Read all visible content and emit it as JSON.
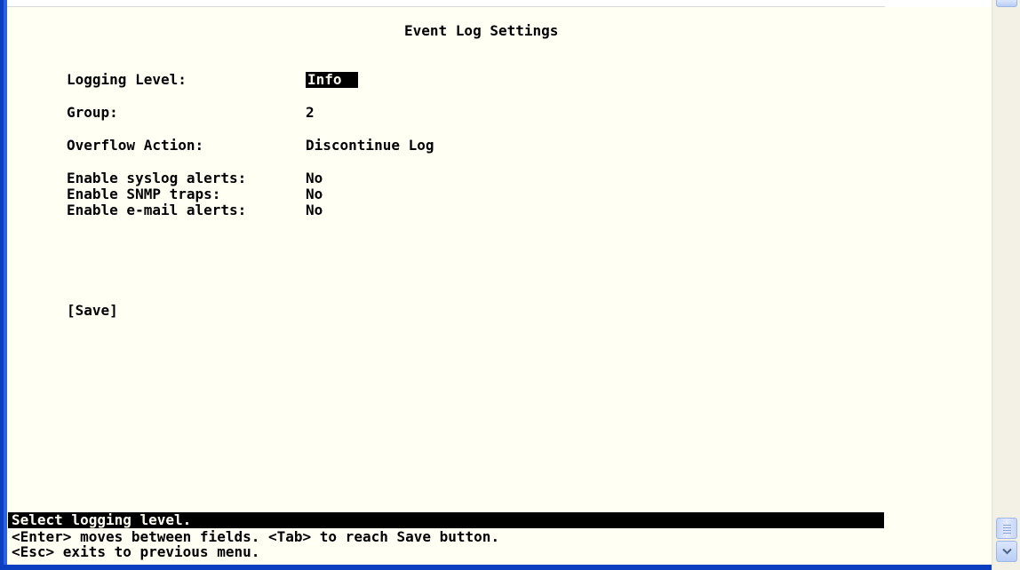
{
  "screen": {
    "title": "Event Log Settings",
    "fields": [
      {
        "label": "Logging Level:",
        "value": "Info"
      },
      {
        "label": "Group:",
        "value": "2"
      },
      {
        "label": "Overflow Action:",
        "value": "Discontinue Log"
      },
      {
        "label": "Enable syslog alerts:",
        "value": "No"
      },
      {
        "label": "Enable SNMP traps:",
        "value": "No"
      },
      {
        "label": "Enable e-mail alerts:",
        "value": "No"
      }
    ],
    "save_label": "[Save]"
  },
  "status": {
    "message": "Select logging level.",
    "help_line_1": "<Enter> moves between fields. <Tab> to reach Save button.",
    "help_line_2": "<Esc> exits to previous menu."
  },
  "colors": {
    "terminal_background": "#fffff4",
    "text": "#000000",
    "highlight_background": "#000000",
    "highlight_text": "#fffff4",
    "window_border": "#0b3fbf"
  },
  "icons": {
    "scroll_down": "chevron-down-icon"
  }
}
